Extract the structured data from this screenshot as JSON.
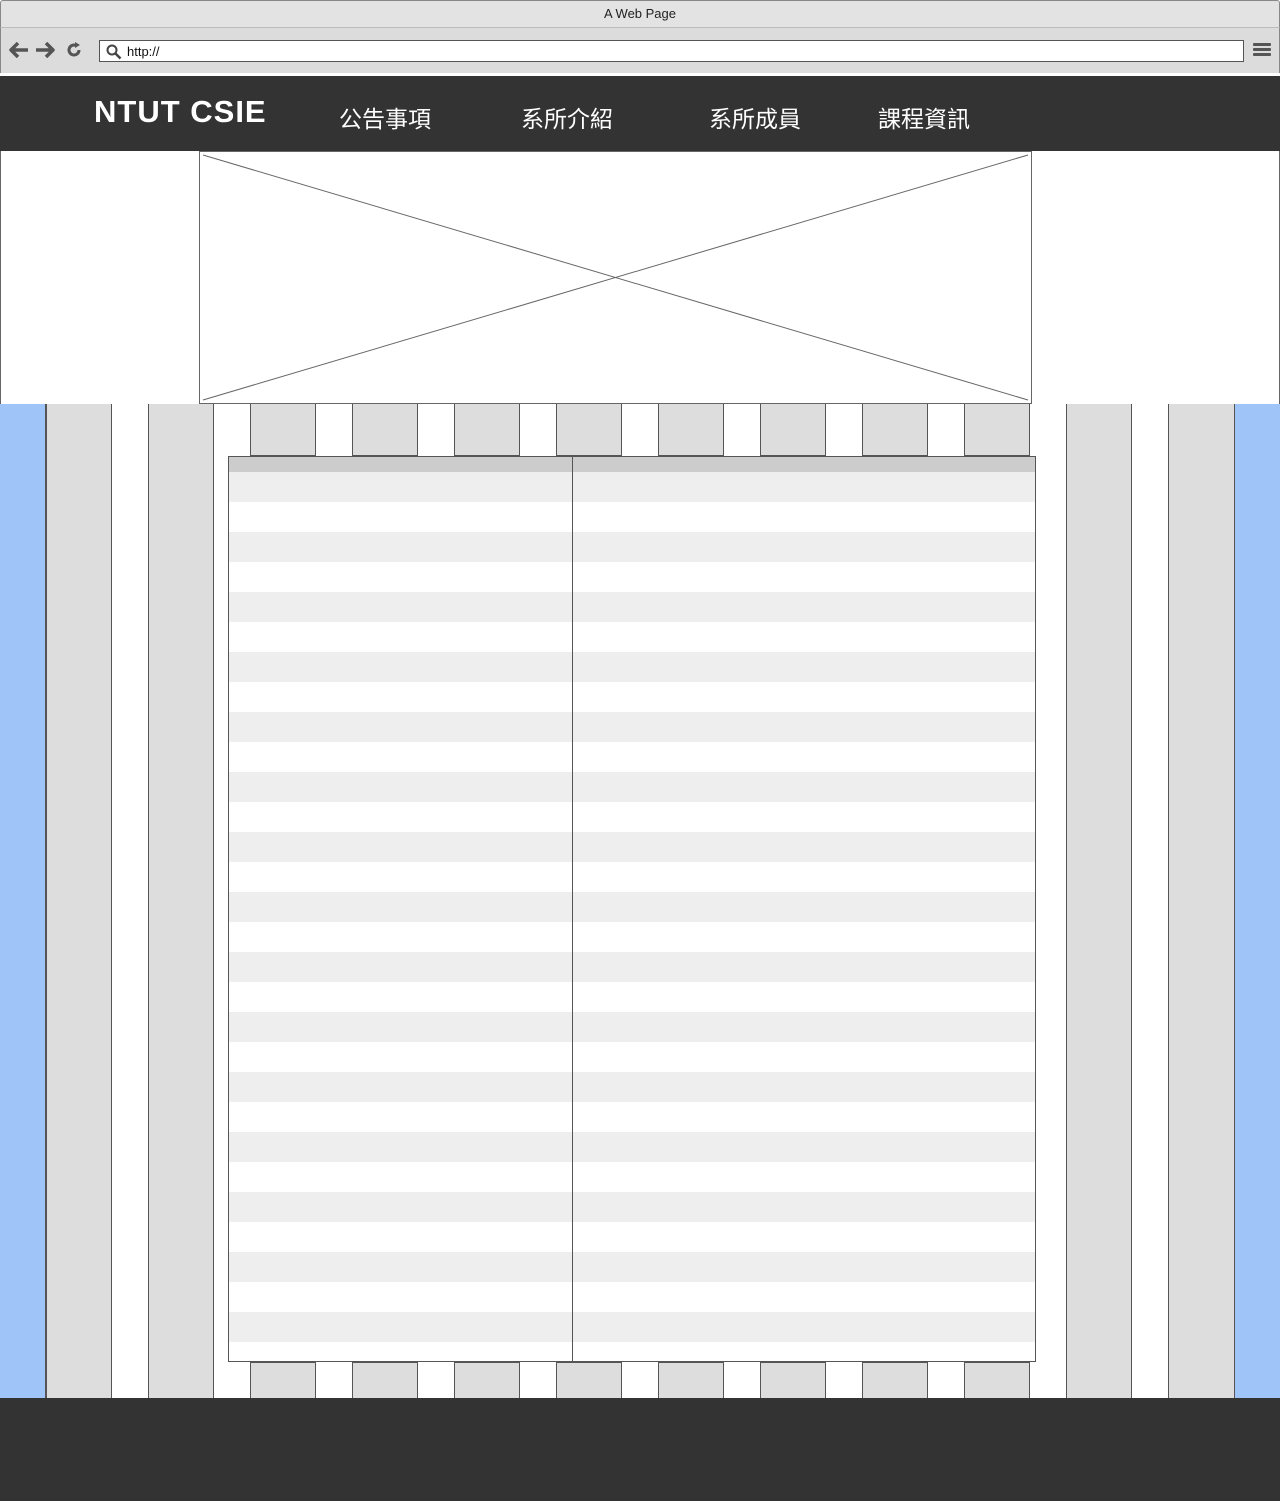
{
  "browser": {
    "window_title": "A Web Page",
    "address": "http://",
    "icons": [
      "back-arrow-icon",
      "forward-arrow-icon",
      "reload-icon",
      "search-icon",
      "menu-icon"
    ]
  },
  "header": {
    "logo": "NTUT CSIE",
    "nav": [
      {
        "label": "公告事項"
      },
      {
        "label": "系所介紹"
      },
      {
        "label": "系所成員"
      },
      {
        "label": "課程資訊"
      }
    ]
  },
  "hero": {
    "image": "image-placeholder"
  },
  "table": {
    "columns": 2,
    "rows": 29
  },
  "colors": {
    "header_bg": "#333333",
    "grid_accent": "#9fc5f8",
    "grid_gray": "#dddddd",
    "row_alt": "#eeeeee"
  }
}
